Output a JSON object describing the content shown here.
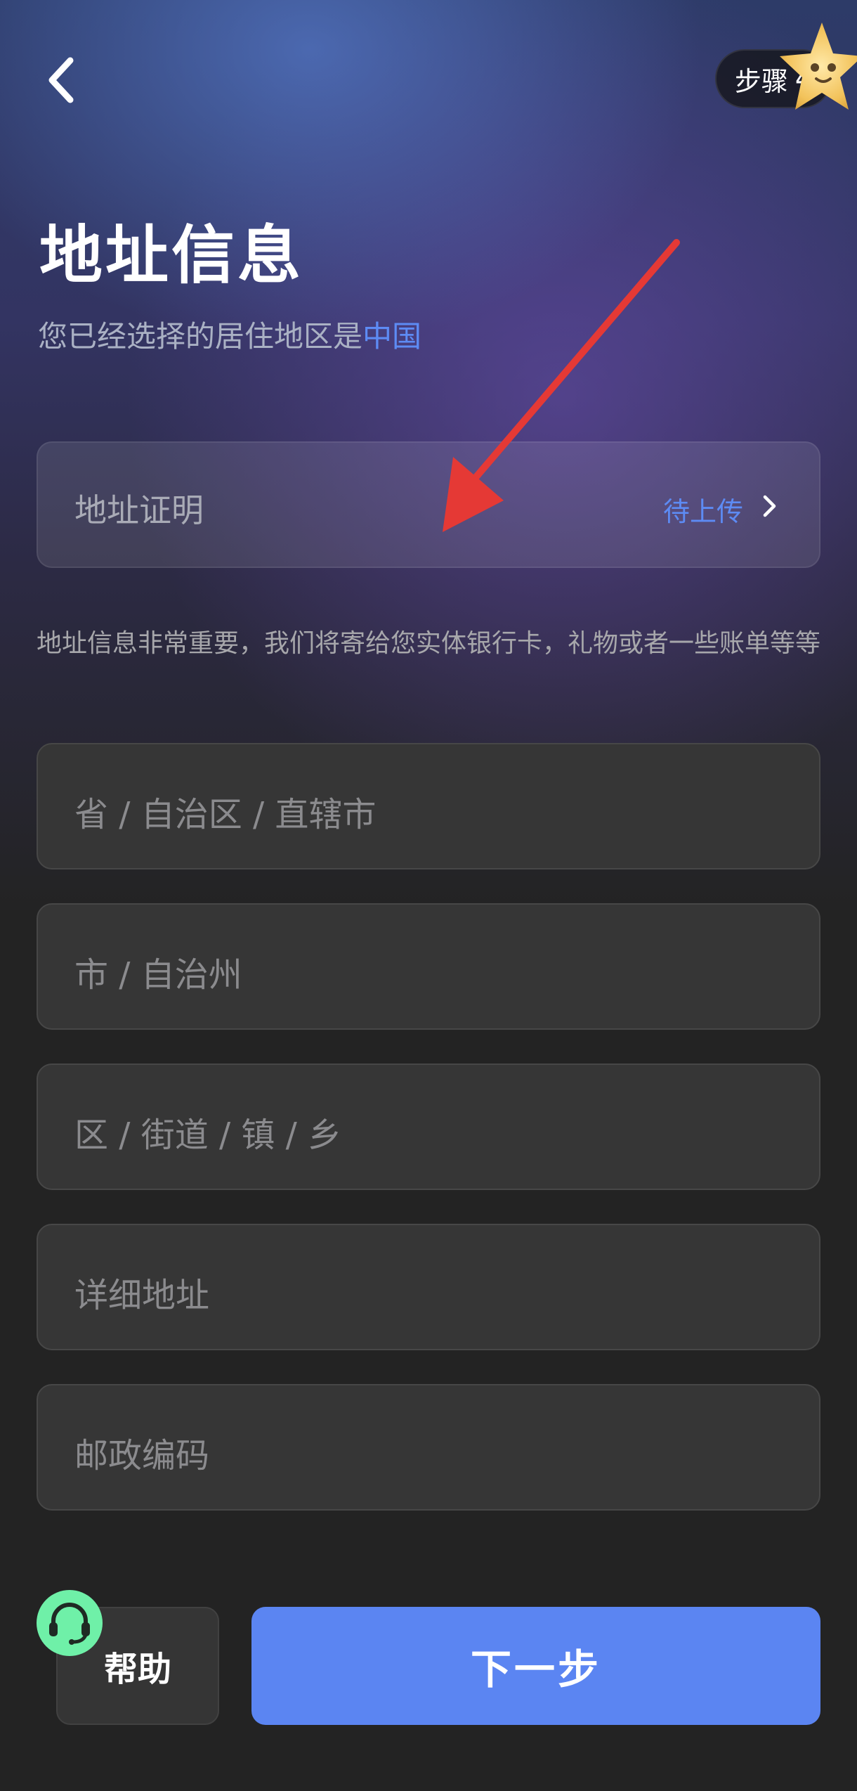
{
  "header": {
    "step_label": "步骤",
    "step_number": "4"
  },
  "page": {
    "title": "地址信息",
    "subtitle_prefix": "您已经选择的居住地区是",
    "country": "中国"
  },
  "address_proof": {
    "label": "地址证明",
    "status": "待上传"
  },
  "notice": "地址信息非常重要，我们将寄给您实体银行卡，礼物或者一些账单等等",
  "fields": {
    "province": {
      "placeholder": "省 / 自治区 / 直辖市"
    },
    "city": {
      "placeholder": "市 / 自治州"
    },
    "district": {
      "placeholder": "区 / 街道 / 镇 / 乡"
    },
    "detail": {
      "placeholder": "详细地址"
    },
    "postal": {
      "placeholder": "邮政编码"
    }
  },
  "footer": {
    "help_label": "帮助",
    "next_label": "下一步"
  },
  "colors": {
    "accent": "#5b85f2",
    "link": "#5d8bf4",
    "help_icon_bg": "#6ff0a8",
    "annotation_arrow": "#e53935"
  },
  "icons": {
    "back": "chevron-left-icon",
    "proof": "chevron-right-icon",
    "help": "headset-icon",
    "mascot": "star-mascot-icon"
  }
}
